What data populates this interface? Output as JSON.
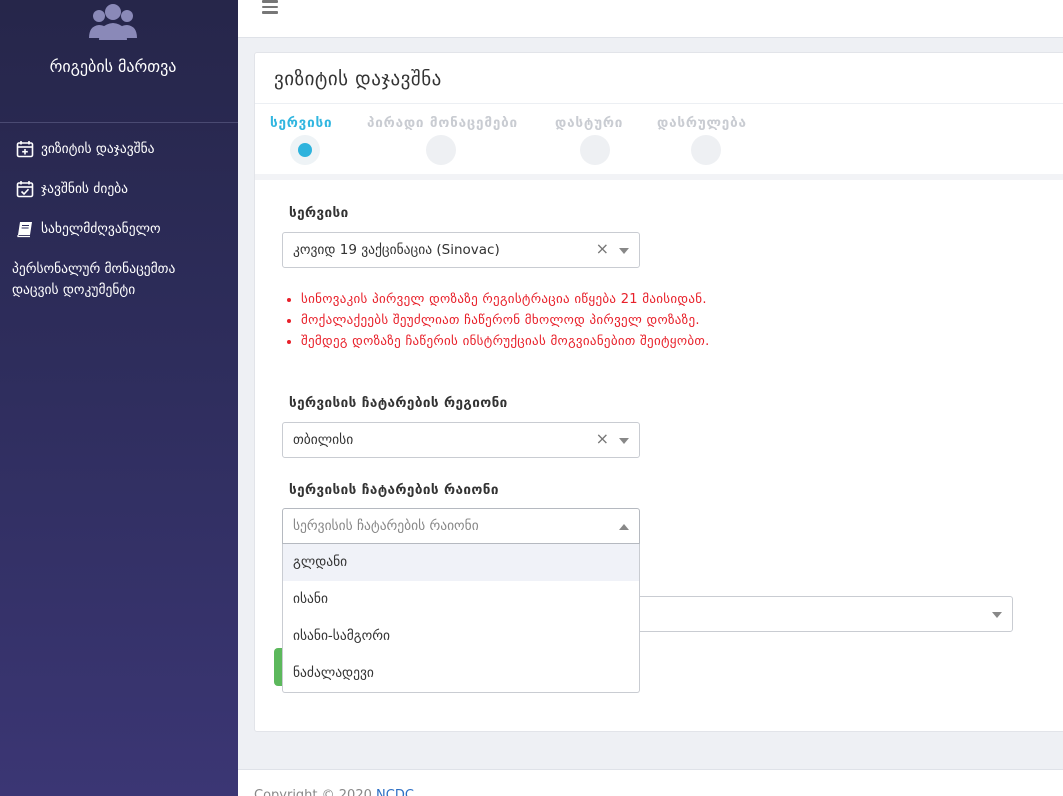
{
  "sidebar": {
    "brand_icon": "users-group-icon",
    "title": "რიგების მართვა",
    "items": [
      {
        "label": "ვიზიტის დაჯავშნა",
        "icon": "calendar-plus-icon"
      },
      {
        "label": "ჯავშნის ძიება",
        "icon": "calendar-check-icon"
      },
      {
        "label": "სახელმძღვანელო",
        "icon": "book-icon"
      }
    ],
    "personal_data_link": "პერსონალურ მონაცემთა დაცვის დოკუმენტი"
  },
  "topbar": {
    "menu_icon": "hamburger-icon"
  },
  "card": {
    "title": "ვიზიტის დაჯავშნა",
    "steps": [
      {
        "label": "სერვისი",
        "active": true
      },
      {
        "label": "პირადი მონაცემები",
        "active": false
      },
      {
        "label": "დასტური",
        "active": false
      },
      {
        "label": "დასრულება",
        "active": false
      }
    ]
  },
  "form": {
    "service_label": "სერვისი",
    "service_value": "კოვიდ 19 ვაქცინაცია (Sinovac)",
    "clear_symbol": "×",
    "warnings": [
      "სინოვაკის პირველ დოზაზე რეგისტრაცია იწყება 21 მაისიდან.",
      "მოქალაქეებს შეუძლიათ ჩაწერონ მხოლოდ პირველ დოზაზე.",
      "შემდეგ დოზაზე ჩაწერის ინსტრუქციას მოგვიანებით შეიტყობთ."
    ],
    "region_label": "სერვისის ჩატარების რეგიონი",
    "region_value": "თბილისი",
    "district_label": "სერვისის ჩატარების რაიონი",
    "district_placeholder": "სერვისის ჩატარების რაიონი",
    "district_options": [
      "გლდანი",
      "ისანი",
      "ისანი-სამგორი",
      "ნაძალადევი"
    ]
  },
  "footer": {
    "copyright": "Copyright © 2020",
    "link": "NCDC"
  },
  "colors": {
    "sidebar_top": "#26264a",
    "sidebar_bottom": "#3b3674",
    "accent": "#2eb3dd",
    "warning": "#e8202a",
    "button_green": "#5cb85c"
  }
}
